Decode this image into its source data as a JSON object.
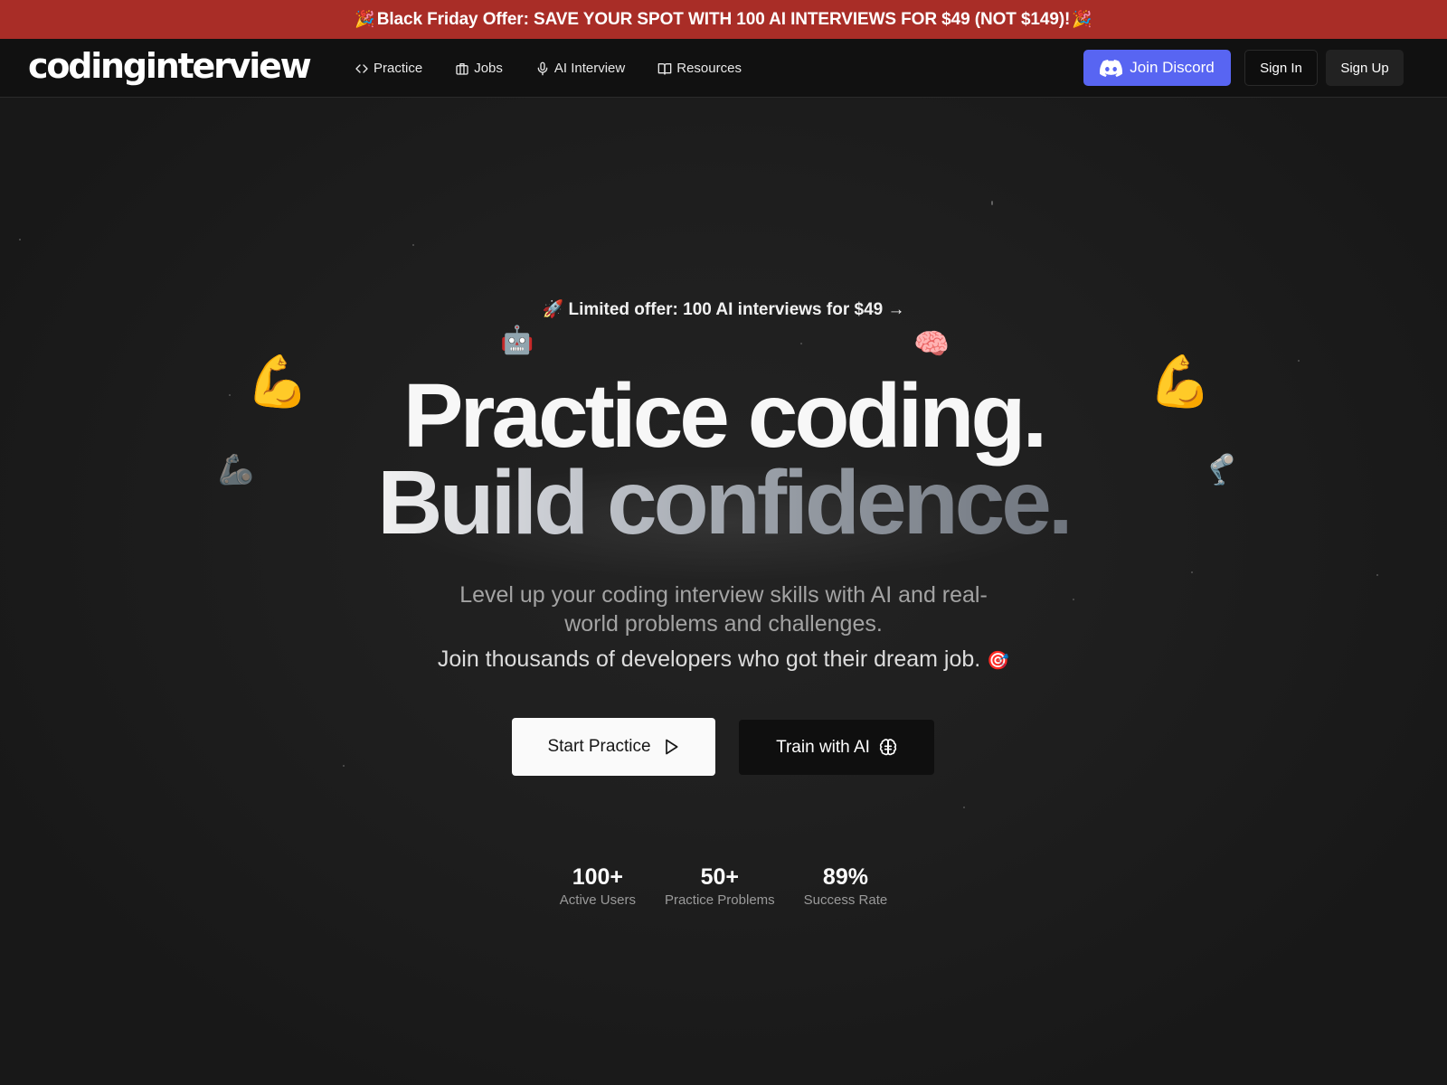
{
  "promo": {
    "emoji_left": "🎉",
    "text": "Black Friday Offer: SAVE YOUR SPOT WITH 100 AI INTERVIEWS FOR $49 (NOT $149)!",
    "emoji_right": "🎉",
    "background": "#a92d27"
  },
  "nav": {
    "logo": "codinginterview",
    "links": [
      {
        "label": "Practice",
        "icon": "code-icon"
      },
      {
        "label": "Jobs",
        "icon": "briefcase-icon"
      },
      {
        "label": "AI Interview",
        "icon": "microphone-icon"
      },
      {
        "label": "Resources",
        "icon": "book-icon"
      }
    ],
    "discord_label": "Join Discord",
    "discord_color": "#5865f2",
    "signin_label": "Sign In",
    "signup_label": "Sign Up"
  },
  "hero": {
    "offer_emoji": "🚀",
    "offer_text": "Limited offer: 100 AI interviews for $49",
    "offer_arrow": "→",
    "headline_line1": "Practice coding.",
    "headline_line2": "Build confidence.",
    "subtitle": "Level up your coding interview skills with AI and real-world problems and challenges.",
    "subtitle2": "Join thousands of developers who got their dream job.",
    "subtitle2_emoji": "🎯",
    "floating_emojis": {
      "robot": "🤖",
      "brain": "🧠",
      "muscle_left": "💪",
      "muscle_right": "💪",
      "mech_arm": "🦾",
      "mech_leg": "🦿"
    },
    "start_label": "Start Practice",
    "train_label": "Train with AI"
  },
  "stats": [
    {
      "value": "100+",
      "label": "Active Users"
    },
    {
      "value": "50+",
      "label": "Practice Problems"
    },
    {
      "value": "89%",
      "label": "Success Rate"
    }
  ]
}
